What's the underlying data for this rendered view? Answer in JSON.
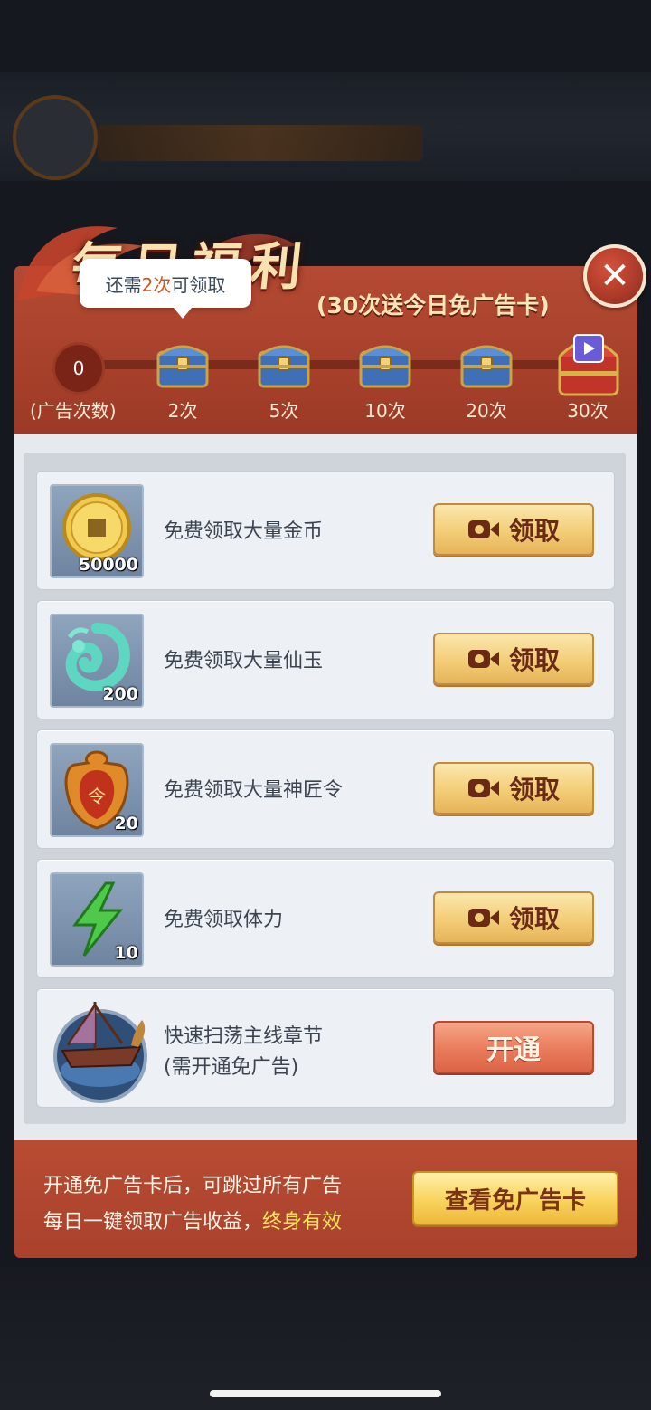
{
  "header": {
    "title": "每日福利",
    "subtitle": "(30次送今日免广告卡)",
    "close_symbol": "✕"
  },
  "tooltip": {
    "prefix": "还需",
    "highlight": "2次",
    "suffix": "可领取"
  },
  "progress": {
    "current_count": "0",
    "count_label": "(广告次数)",
    "milestones": [
      {
        "label": "2次"
      },
      {
        "label": "5次"
      },
      {
        "label": "10次"
      },
      {
        "label": "20次"
      },
      {
        "label": "30次"
      }
    ]
  },
  "rewards": [
    {
      "name": "免费领取大量金币",
      "qty": "50000",
      "icon": "gold-coin-icon",
      "button": "领取"
    },
    {
      "name": "免费领取大量仙玉",
      "qty": "200",
      "icon": "jade-dragon-icon",
      "button": "领取"
    },
    {
      "name": "免费领取大量神匠令",
      "qty": "20",
      "icon": "craft-token-icon",
      "button": "领取"
    },
    {
      "name": "免费领取体力",
      "qty": "10",
      "icon": "lightning-icon",
      "button": "领取"
    }
  ],
  "sweep": {
    "line1": "快速扫荡主线章节",
    "line2": "(需开通免广告)",
    "button": "开通",
    "icon": "dragon-ship-icon"
  },
  "footer": {
    "line1": "开通免广告卡后，可跳过所有广告",
    "line2_prefix": "每日一键领取广告收益，",
    "line2_highlight": "终身有效",
    "button": "查看免广告卡"
  },
  "colors": {
    "panel_red": "#b44a33",
    "button_gold": "#f3cd77",
    "button_orange": "#e97b5c",
    "highlight_yellow": "#ffe55c"
  }
}
